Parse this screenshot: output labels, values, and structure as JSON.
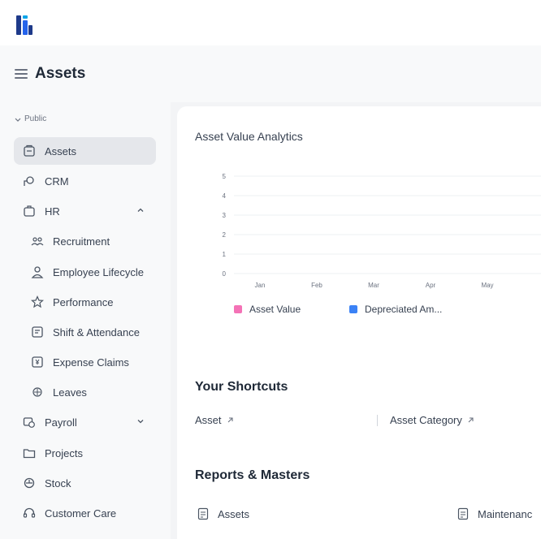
{
  "app": {
    "logo_icon": "logo-icon",
    "page_title": "Assets"
  },
  "sidebar": {
    "workspace_label": "Public",
    "items": [
      {
        "label": "Assets",
        "icon": "asset-icon",
        "active": true
      },
      {
        "label": "CRM",
        "icon": "crm-icon"
      },
      {
        "label": "HR",
        "icon": "hr-icon",
        "expanded": true
      },
      {
        "label": "Recruitment",
        "icon": "people-icon",
        "child": true
      },
      {
        "label": "Employee Lifecycle",
        "icon": "user-icon",
        "child": true
      },
      {
        "label": "Performance",
        "icon": "star-icon",
        "child": true
      },
      {
        "label": "Shift & Attendance",
        "icon": "calendar-icon",
        "child": true
      },
      {
        "label": "Expense Claims",
        "icon": "receipt-icon",
        "child": true
      },
      {
        "label": "Leaves",
        "icon": "leaves-icon",
        "child": true
      },
      {
        "label": "Payroll",
        "icon": "payroll-icon",
        "expanded": false
      },
      {
        "label": "Projects",
        "icon": "folder-icon"
      },
      {
        "label": "Stock",
        "icon": "stock-icon"
      },
      {
        "label": "Customer Care",
        "icon": "headset-icon"
      }
    ]
  },
  "main": {
    "chart_title": "Asset Value Analytics",
    "shortcuts_title": "Your Shortcuts",
    "shortcuts": [
      {
        "label": "Asset",
        "icon": "arrow-up-right-icon"
      },
      {
        "label": "Asset Category",
        "icon": "arrow-up-right-icon"
      }
    ],
    "reports_title": "Reports & Masters",
    "reports": [
      {
        "label": "Assets",
        "icon": "doc-icon"
      },
      {
        "label": "Maintenanc",
        "icon": "doc-icon"
      }
    ]
  },
  "chart_data": {
    "type": "bar",
    "categories": [
      "Jan",
      "Feb",
      "Mar",
      "Apr",
      "May"
    ],
    "y_ticks": [
      "5",
      "4",
      "3",
      "2",
      "1",
      "0"
    ],
    "ylim": [
      0,
      5
    ],
    "series": [
      {
        "name": "Asset Value",
        "values": [
          0,
          0,
          0,
          0,
          0
        ],
        "color": "#f472b6"
      },
      {
        "name": "Depreciated Am...",
        "values": [
          0,
          0,
          0,
          0,
          0
        ],
        "color": "#3b82f6"
      }
    ],
    "grid": true,
    "legend_position": "bottom-left"
  },
  "colors": {
    "accent": "#1e3a8a",
    "logo_bg": "#1e40af",
    "pink": "#f472b6",
    "blue": "#3b82f6"
  }
}
